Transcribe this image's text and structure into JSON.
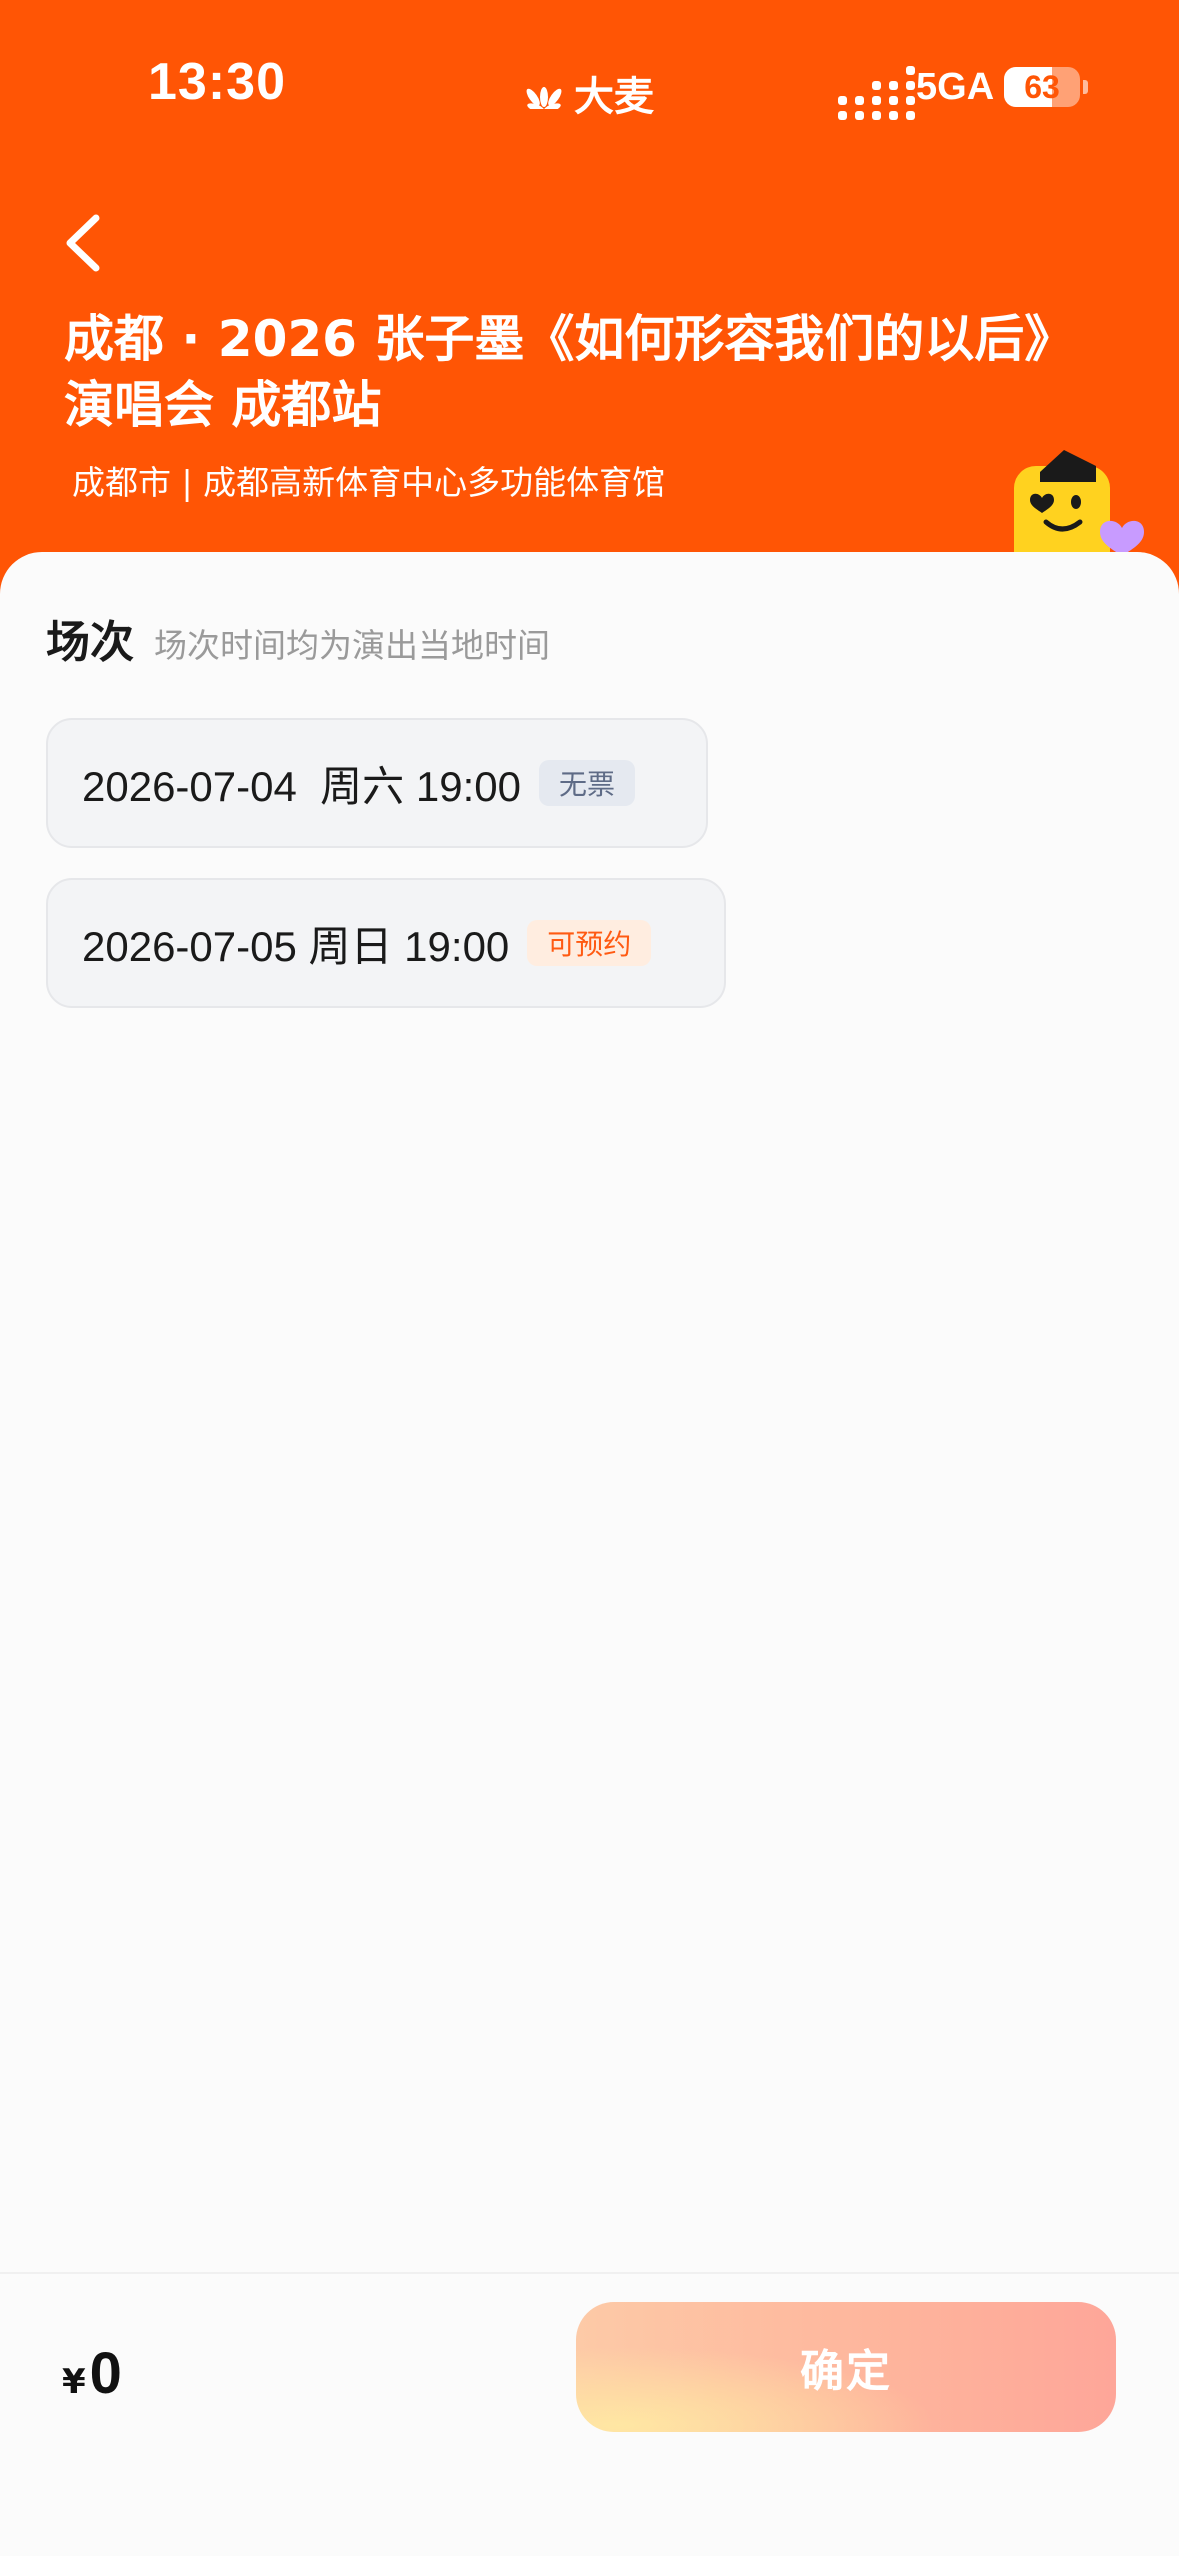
{
  "status_bar": {
    "time": "13:30",
    "brand": "大麦",
    "network": "5GA",
    "battery": "63",
    "battery_fraction": 0.63
  },
  "event": {
    "title": "成都 · 2026 张子墨《如何形容我们的以后》演唱会 成都站",
    "venue": "成都市 | 成都高新体育中心多功能体育馆"
  },
  "sessions_section": {
    "title": "场次",
    "hint": "场次时间均为演出当地时间",
    "items": [
      {
        "text": "2026-07-04  周六 19:00",
        "tag": "无票"
      },
      {
        "text": "2026-07-05 周日 19:00",
        "tag": "可预约"
      }
    ]
  },
  "footer": {
    "currency": "¥",
    "amount": "0",
    "confirm_label": "确定"
  },
  "colors": {
    "brand_orange": "#ff5505",
    "tag_reserve": "#ff5a12",
    "tag_none": "#5e6b86"
  },
  "icons": {
    "back": "chevron-left-icon",
    "brand_logo": "damai-logo-icon",
    "mascot": "mascot-icon"
  }
}
